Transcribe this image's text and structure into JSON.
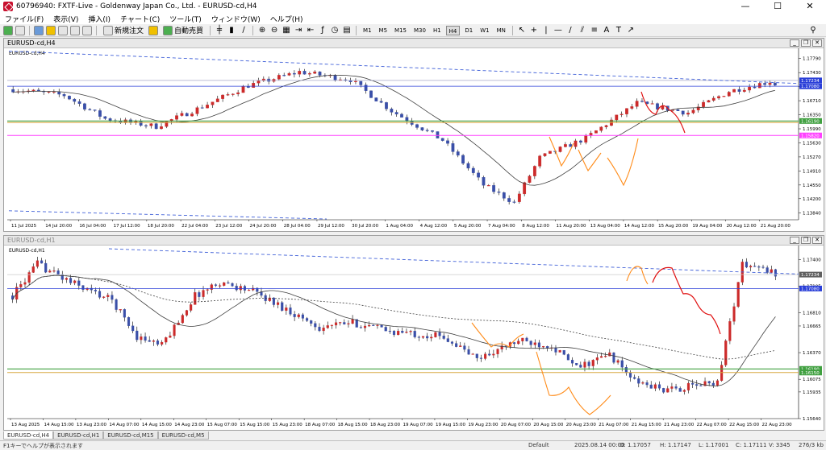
{
  "window": {
    "title": "60796940: FXTF-Live - Goldenway Japan Co., Ltd. - EURUSD-cd,H4",
    "minimize": "—",
    "maximize": "☐",
    "close": "✕"
  },
  "menu": [
    "ファイル(F)",
    "表示(V)",
    "挿入(I)",
    "チャート(C)",
    "ツール(T)",
    "ウィンドウ(W)",
    "ヘルプ(H)"
  ],
  "toolbar": {
    "new_order": "新規注文",
    "auto_trade": "自動売買",
    "timeframes": [
      "M1",
      "M5",
      "M15",
      "M30",
      "H1",
      "H4",
      "D1",
      "W1",
      "MN"
    ],
    "active_timeframe": "H4"
  },
  "colors": {
    "bull": "#cc2a2a",
    "bear": "#3a4fa8",
    "ma": "#404040",
    "trend": "#4060d8",
    "orange": "#ff8c1a",
    "forecast": "#e01010",
    "green_level": "#40a040",
    "magenta_level": "#ff40ff",
    "blue_level": "#2a3fd8",
    "grey_level": "#a8a8c8"
  },
  "charts": {
    "h4": {
      "name": "EURUSD-cd,H4",
      "header": "EURUSD-cd,H4",
      "price_ticks": [
        "1.17790",
        "1.17430",
        "1.17070",
        "1.16710",
        "1.16350",
        "1.15990",
        "1.15630",
        "1.15270",
        "1.14910",
        "1.14550",
        "1.14200",
        "1.13840"
      ],
      "price_min": 1.1366,
      "price_max": 1.1797,
      "level_labels": [
        {
          "value": 1.1723,
          "text": "1.17234",
          "fill": "#2a3fd8"
        },
        {
          "value": 1.1708,
          "text": "1.17080",
          "fill": "#2a3fd8"
        },
        {
          "value": 1.1619,
          "text": "1.16190",
          "fill": "#40a040"
        },
        {
          "value": 1.1582,
          "text": "1.15820",
          "fill": "#ff40ff"
        }
      ],
      "time_labels": [
        "11 Jul 2025",
        "14 Jul 20:00",
        "16 Jul 04:00",
        "17 Jul 12:00",
        "18 Jul 20:00",
        "22 Jul 04:00",
        "23 Jul 12:00",
        "24 Jul 20:00",
        "28 Jul 04:00",
        "29 Jul 12:00",
        "30 Jul 20:00",
        "1 Aug 04:00",
        "4 Aug 12:00",
        "5 Aug 20:00",
        "7 Aug 04:00",
        "8 Aug 12:00",
        "11 Aug 20:00",
        "13 Aug 04:00",
        "14 Aug 12:00",
        "15 Aug 20:00",
        "19 Aug 04:00",
        "20 Aug 12:00",
        "21 Aug 20:00"
      ]
    },
    "h1": {
      "name": "EURUSD-cd,H1",
      "header": "EURUSD-cd,H1",
      "price_ticks": [
        "1.17400",
        "1.17105",
        "1.16810",
        "1.16665",
        "1.16370",
        "1.16075",
        "1.15935",
        "1.15640"
      ],
      "price_tick_values": [
        1.174,
        1.17105,
        1.1681,
        1.16665,
        1.1637,
        1.16075,
        1.15935,
        1.1564
      ],
      "price_min": 1.1564,
      "price_max": 1.1752,
      "level_labels": [
        {
          "value": 1.17234,
          "text": "1.17234",
          "fill": "#606060"
        },
        {
          "value": 1.1708,
          "text": "1.17080",
          "fill": "#2a3fd8"
        },
        {
          "value": 1.1619,
          "text": "1.16190",
          "fill": "#40a040"
        },
        {
          "value": 1.1615,
          "text": "1.16150",
          "fill": "#40a040"
        }
      ],
      "time_labels": [
        "13 Aug 2025",
        "14 Aug 15:00",
        "13 Aug 23:00",
        "14 Aug 07:00",
        "14 Aug 15:00",
        "14 Aug 23:00",
        "15 Aug 07:00",
        "15 Aug 15:00",
        "15 Aug 23:00",
        "18 Aug 07:00",
        "18 Aug 15:00",
        "18 Aug 23:00",
        "19 Aug 07:00",
        "19 Aug 15:00",
        "19 Aug 23:00",
        "20 Aug 07:00",
        "20 Aug 15:00",
        "20 Aug 23:00",
        "21 Aug 07:00",
        "21 Aug 15:00",
        "21 Aug 23:00",
        "22 Aug 07:00",
        "22 Aug 15:00",
        "22 Aug 23:00"
      ]
    }
  },
  "tabs": [
    "EURUSD-cd,H4",
    "EURUSD-cd,H1",
    "EURUSD-cd,M15",
    "EURUSD-cd,M5"
  ],
  "active_tab": "EURUSD-cd,H4",
  "status": {
    "help": "F1キーでヘルプが表示されます",
    "profile": "Default",
    "datetime": "2025.08.14 00:00",
    "open": "O: 1.17057",
    "high": "H: 1.17147",
    "low": "L: 1.17001",
    "close": "C: 1.17111",
    "volume": "V: 3345",
    "traffic": "276/3 kb"
  }
}
